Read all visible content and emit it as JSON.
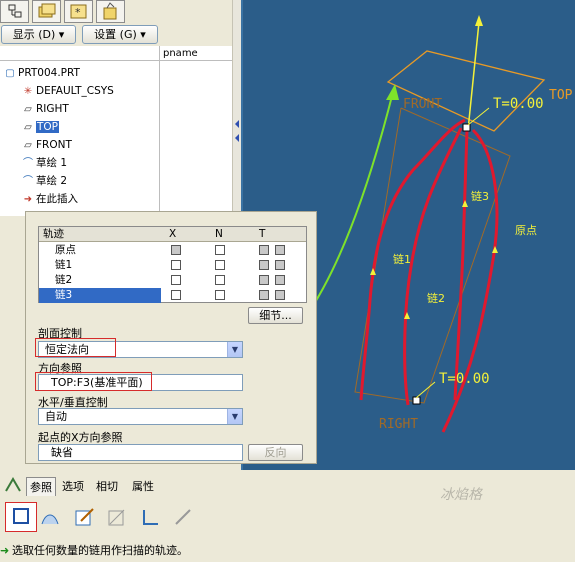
{
  "toolbar": {
    "show_label": "显示 (D)",
    "settings_label": "设置 (G)"
  },
  "tree": {
    "column_pname": "pname",
    "items": [
      {
        "label": "PRT004.PRT",
        "icon": "part-icon"
      },
      {
        "label": "DEFAULT_CSYS",
        "icon": "csys-icon"
      },
      {
        "label": "RIGHT",
        "icon": "datum-plane-icon"
      },
      {
        "label": "TOP",
        "icon": "datum-plane-icon",
        "selected": true
      },
      {
        "label": "FRONT",
        "icon": "datum-plane-icon"
      },
      {
        "label": "草绘 1",
        "icon": "sketch-icon"
      },
      {
        "label": "草绘 2",
        "icon": "sketch-icon"
      },
      {
        "label": "在此插入",
        "icon": "insert-arrow-icon"
      }
    ]
  },
  "viewport": {
    "labels": {
      "front": "FRONT",
      "top": "TOP",
      "t_top": "T=0.00",
      "t_bottom": "T=0.00",
      "right": "RIGHT",
      "chain3": "链3",
      "chain1": "链1",
      "chain2": "链2",
      "origin": "原点"
    },
    "watermark": "冰焰格"
  },
  "panel": {
    "grid": {
      "headers": [
        "轨迹",
        "X",
        "N",
        "T"
      ],
      "rows": [
        {
          "name": "原点",
          "x_gray": true
        },
        {
          "name": "链1"
        },
        {
          "name": "链2"
        },
        {
          "name": "链3",
          "selected": true
        }
      ]
    },
    "details_button": "细节...",
    "section_control_label": "剖面控制",
    "section_control_value": "恒定法向",
    "direction_ref_label": "方向参照",
    "direction_ref_value": "TOP:F3(基准平面)",
    "hv_control_label": "水平/垂直控制",
    "hv_control_value": "自动",
    "x_dir_label": "起点的X方向参照",
    "x_dir_value": "缺省",
    "flip_button": "反向"
  },
  "tabs": [
    "参照",
    "选项",
    "相切",
    "属性"
  ],
  "status_text": "选取任何数量的链用作扫描的轨迹。",
  "colors": {
    "viewport_bg": "#2b5d89",
    "curve": "#e0192e",
    "datum": "#e89a26",
    "annotation_yellow": "#f4f13a",
    "arrow_green": "#7ee22a"
  }
}
